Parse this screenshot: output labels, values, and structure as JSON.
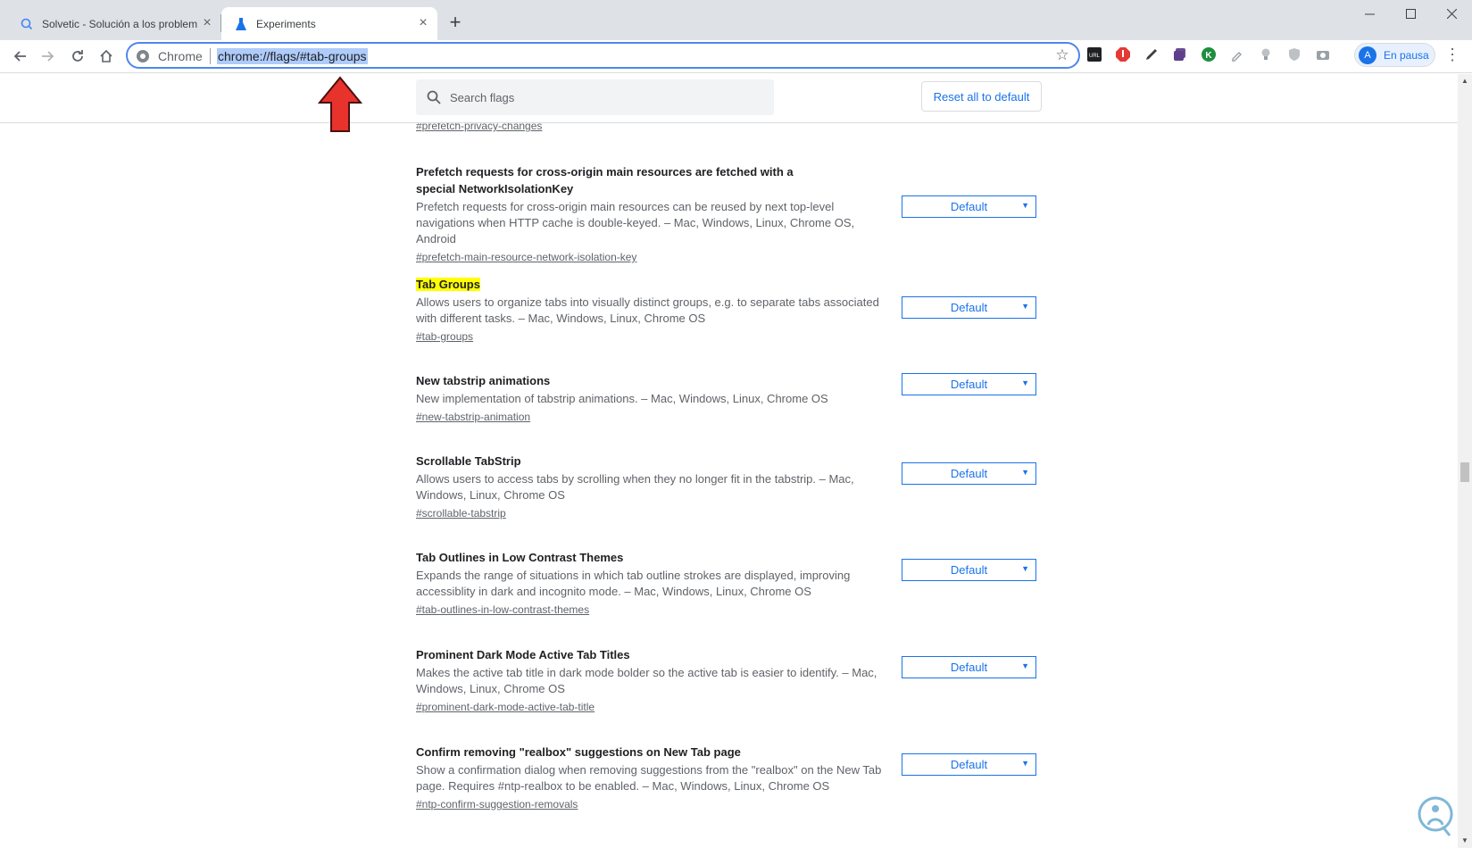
{
  "tabs": [
    {
      "title": "Solvetic - Solución a los problem",
      "active": false,
      "icon": "search-q-icon"
    },
    {
      "title": "Experiments",
      "active": true,
      "icon": "flask-icon"
    }
  ],
  "window_controls": [
    "minimize",
    "maximize",
    "close"
  ],
  "omnibox": {
    "chip": "Chrome",
    "url": "chrome://flags/#tab-groups"
  },
  "profile": {
    "initial": "A",
    "label": "En pausa"
  },
  "search": {
    "placeholder": "Search flags"
  },
  "reset_button": "Reset all to default",
  "top_link": "#prefetch-privacy-changes",
  "flags": [
    {
      "title": "Prefetch requests for cross-origin main resources are fetched with a special NetworkIsolationKey",
      "description": "Prefetch requests for cross-origin main resources can be reused by next top-level navigations when HTTP cache is double-keyed. – Mac, Windows, Linux, Chrome OS, Android",
      "link": "#prefetch-main-resource-network-isolation-key",
      "value": "Default",
      "highlighted": false
    },
    {
      "title": "Tab Groups",
      "description": "Allows users to organize tabs into visually distinct groups, e.g. to separate tabs associated with different tasks. – Mac, Windows, Linux, Chrome OS",
      "link": "#tab-groups",
      "value": "Default",
      "highlighted": true
    },
    {
      "title": "New tabstrip animations",
      "description": "New implementation of tabstrip animations. – Mac, Windows, Linux, Chrome OS",
      "link": "#new-tabstrip-animation",
      "value": "Default",
      "highlighted": false
    },
    {
      "title": "Scrollable TabStrip",
      "description": "Allows users to access tabs by scrolling when they no longer fit in the tabstrip. – Mac, Windows, Linux, Chrome OS",
      "link": "#scrollable-tabstrip",
      "value": "Default",
      "highlighted": false
    },
    {
      "title": "Tab Outlines in Low Contrast Themes",
      "description": "Expands the range of situations in which tab outline strokes are displayed, improving accessiblity in dark and incognito mode. – Mac, Windows, Linux, Chrome OS",
      "link": "#tab-outlines-in-low-contrast-themes",
      "value": "Default",
      "highlighted": false
    },
    {
      "title": "Prominent Dark Mode Active Tab Titles",
      "description": "Makes the active tab title in dark mode bolder so the active tab is easier to identify. – Mac, Windows, Linux, Chrome OS",
      "link": "#prominent-dark-mode-active-tab-title",
      "value": "Default",
      "highlighted": false
    },
    {
      "title": "Confirm removing \"realbox\" suggestions on New Tab page",
      "description": "Show a confirmation dialog when removing suggestions from the \"realbox\" on the New Tab page. Requires #ntp-realbox to be enabled. – Mac, Windows, Linux, Chrome OS",
      "link": "#ntp-confirm-suggestion-removals",
      "value": "Default",
      "highlighted": false
    }
  ],
  "colors": {
    "accent": "#1a73e8",
    "highlight": "#ffff00",
    "arrow": "#e8322c"
  }
}
